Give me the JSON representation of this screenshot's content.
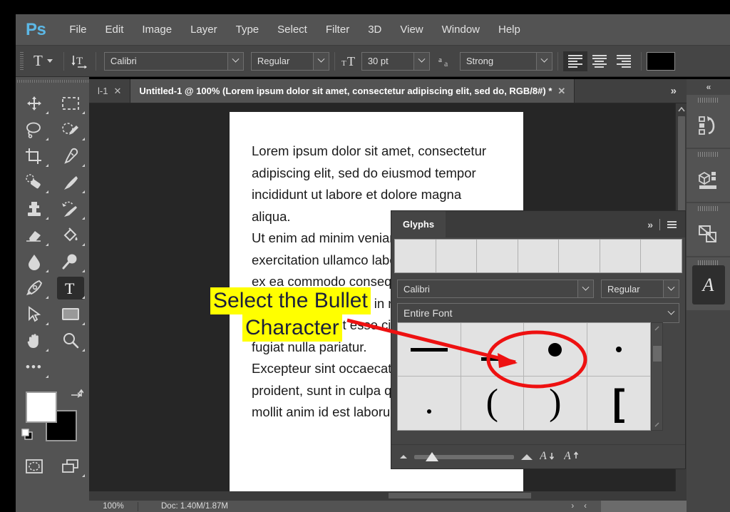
{
  "app": {
    "logo": "Ps",
    "menus": [
      "File",
      "Edit",
      "Image",
      "Layer",
      "Type",
      "Select",
      "Filter",
      "3D",
      "View",
      "Window",
      "Help"
    ]
  },
  "options_bar": {
    "tool_icon": "text-tool-icon",
    "orientation_icon": "toggle-text-orientation-icon",
    "font_family": "Calibri",
    "font_style": "Regular",
    "size_icon": "font-size-icon",
    "font_size": "30 pt",
    "antialias_icon": "anti-aliasing-icon",
    "antialias": "Strong",
    "align_left": "align-left",
    "align_center": "align-center",
    "align_right": "align-right",
    "color": "#000000"
  },
  "tabs": {
    "partial_label": "l-1",
    "active_label": "Untitled-1 @ 100% (Lorem ipsum dolor sit amet, consectetur adipiscing elit, sed do, RGB/8#) *",
    "close_glyph": "✕",
    "overflow_glyph": "»"
  },
  "toolbar": {
    "tools": [
      {
        "name": "move-tool",
        "glyph": "move"
      },
      {
        "name": "rectangular-marquee-tool",
        "glyph": "marquee"
      },
      {
        "name": "lasso-tool",
        "glyph": "lasso"
      },
      {
        "name": "quick-selection-tool",
        "glyph": "quickselect"
      },
      {
        "name": "crop-tool",
        "glyph": "crop"
      },
      {
        "name": "eyedropper-tool",
        "glyph": "eyedropper"
      },
      {
        "name": "spot-healing-brush-tool",
        "glyph": "heal"
      },
      {
        "name": "brush-tool",
        "glyph": "brush"
      },
      {
        "name": "clone-stamp-tool",
        "glyph": "stamp"
      },
      {
        "name": "history-brush-tool",
        "glyph": "historybrush"
      },
      {
        "name": "eraser-tool",
        "glyph": "eraser"
      },
      {
        "name": "gradient-tool",
        "glyph": "paintbucket"
      },
      {
        "name": "blur-tool",
        "glyph": "blur"
      },
      {
        "name": "dodge-tool",
        "glyph": "dodge"
      },
      {
        "name": "pen-tool",
        "glyph": "pen"
      },
      {
        "name": "horizontal-type-tool",
        "glyph": "type",
        "active": true
      },
      {
        "name": "path-selection-tool",
        "glyph": "pathselect"
      },
      {
        "name": "rectangle-tool",
        "glyph": "rectangle"
      },
      {
        "name": "hand-tool",
        "glyph": "hand"
      },
      {
        "name": "zoom-tool",
        "glyph": "zoom"
      }
    ],
    "more_tools": "edit-toolbar-ellipsis",
    "foreground_color": "#ffffff",
    "background_color": "#000000",
    "quick_mask": "quick-mask-mode",
    "screen_mode": "screen-mode"
  },
  "document": {
    "paragraphs": [
      "Lorem ipsum dolor sit amet, consectetur",
      "adipiscing elit, sed do eiusmod tempor",
      "incididunt ut labore et dolore magna",
      "aliqua.",
      "Ut enim ad minim veniam, quis nostrud",
      "exercitation ullamco laboris nisi ut aliquip",
      "ex ea commodo consequat.",
      "Duis aute irure dolor in reprehenderit",
      "in voluptate velit esse cillum dolore eu",
      "fugiat nulla pariatur.",
      "Excepteur sint occaecat cupidatat non",
      "proident, sunt in culpa qui officia deserunt",
      "mollit anim id est laborum."
    ]
  },
  "annotations": {
    "line1": "Select the Bullet",
    "line2": "Character",
    "highlight_color": "#ffff00",
    "text_color": "#1b1f3b",
    "marker_color": "#ee1111"
  },
  "glyphs_panel": {
    "tab_label": "Glyphs",
    "collapse_glyph": "»",
    "menu_icon": "panel-menu-icon",
    "recent_cells": 7,
    "font_family": "Calibri",
    "font_style": "Regular",
    "subset": "Entire Font",
    "glyph_cells": [
      {
        "name": "glyph-em-dash",
        "kind": "emdash"
      },
      {
        "name": "glyph-en-dash",
        "kind": "endash"
      },
      {
        "name": "glyph-bullet",
        "kind": "bullet",
        "highlighted": true
      },
      {
        "name": "glyph-small-bullet",
        "kind": "smbullet"
      },
      {
        "name": "glyph-period-dot",
        "kind": "dot"
      },
      {
        "name": "glyph-left-paren",
        "kind": "char",
        "char": "("
      },
      {
        "name": "glyph-right-paren",
        "kind": "char",
        "char": ")"
      },
      {
        "name": "glyph-left-bracket",
        "kind": "bracket",
        "char": "["
      }
    ],
    "zoom_out_icon": "small-mountain-icon",
    "zoom_in_icon": "large-mountain-icon",
    "decrease_size": "𝒜",
    "increase_size": "𝒜"
  },
  "right_rail": {
    "collapse_glyph": "«",
    "panels": [
      {
        "name": "history-panel-icon"
      },
      {
        "name": "libraries-panel-icon"
      },
      {
        "name": "adjustments-panel-icon"
      },
      {
        "name": "glyphs-panel-icon",
        "label": "A",
        "active": true
      }
    ]
  },
  "status_bar": {
    "zoom": "100%",
    "doc_info": "Doc: 1.40M/1.87M",
    "arrow_right": "›",
    "arrow_left": "‹"
  }
}
